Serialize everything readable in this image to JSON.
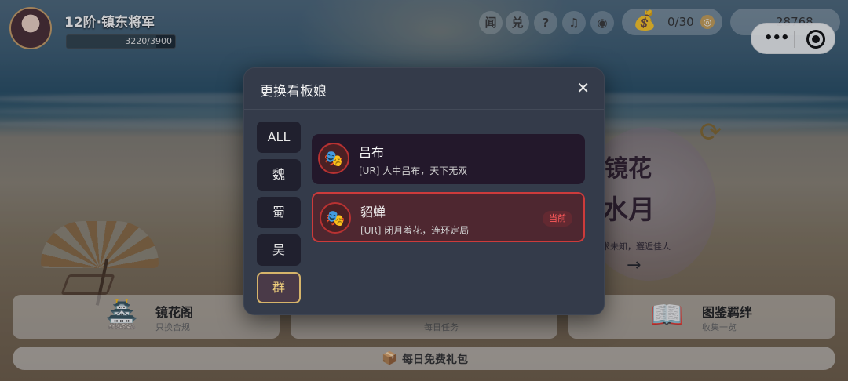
{
  "player": {
    "rank_title": "12阶·镇东将军",
    "exp_text": "3220/3900",
    "exp_progress": 0.826
  },
  "hud": {
    "buttons": [
      {
        "label": "闻"
      },
      {
        "label": "兑"
      },
      {
        "label": "?"
      },
      {
        "label": "♫"
      },
      {
        "label": "◉"
      }
    ],
    "bag_count": "0/30",
    "gold": "28768"
  },
  "scene": {
    "medallion_title_1": "镜花",
    "medallion_title_2": "水月",
    "medallion_sub": "求未知，邂逅佳人",
    "medallion_arrow": "→"
  },
  "bottom": {
    "cards": [
      {
        "title": "镜花阁",
        "sub": "只换合规"
      },
      {
        "title": "",
        "sub": "每日任务"
      },
      {
        "title": "图鉴羁绊",
        "sub": "收集一览"
      }
    ],
    "daily_gift": "每日免费礼包"
  },
  "modal": {
    "title": "更换看板娘",
    "close": "✕",
    "filters": [
      "ALL",
      "魏",
      "蜀",
      "吴",
      "群"
    ],
    "active_filter": "群",
    "characters": [
      {
        "name": "吕布",
        "desc": "[UR] 人中吕布，天下无双",
        "current": false,
        "badge": ""
      },
      {
        "name": "貂蝉",
        "desc": "[UR] 闭月羞花，连环定局",
        "current": true,
        "badge": "当前"
      }
    ]
  },
  "icons": {
    "mask": "🎭",
    "bag": "💰",
    "chest": "📦",
    "book": "📖",
    "pavilion": "🏯",
    "refresh": "⟳"
  },
  "colors": {
    "accent_gold": "#d6b46a",
    "current_red": "#cc3b3b",
    "modal_bg": "#343b4a"
  }
}
